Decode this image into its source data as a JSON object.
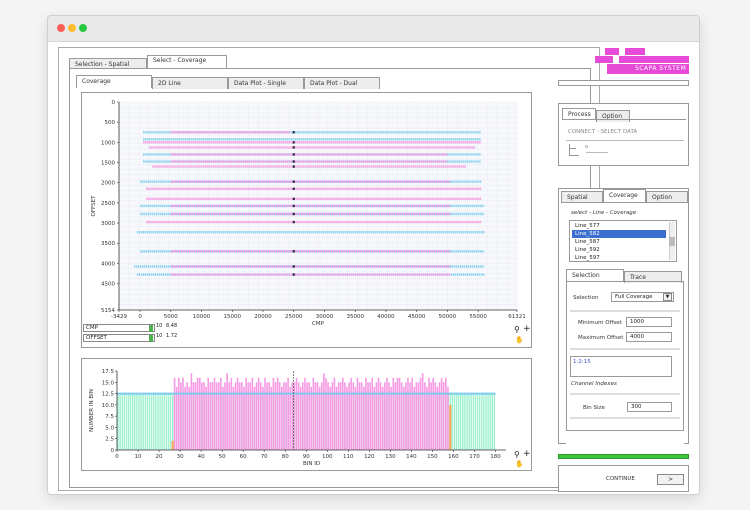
{
  "window": {
    "colors": {
      "close": "#ff5f57",
      "minimize": "#febc2e",
      "maximize": "#28c840"
    }
  },
  "left_tabs": {
    "spatial": "Selection - Spatial",
    "coverage": "Select - Coverage"
  },
  "inner_tabs": [
    "Coverage",
    "2D Line",
    "Data Plot - Single",
    "Data Plot - Dual"
  ],
  "coverage_plot": {
    "controls": {
      "cmp_label": "CMP",
      "offset_label": "OFFSET",
      "cmp_step_a": "10",
      "cmp_step_b": "8.48",
      "offset_step_a": "10",
      "offset_step_b": "1.72"
    }
  },
  "right": {
    "logo_text": "SCAPA SYSTEM",
    "process_tabs": [
      "Process",
      "Option"
    ],
    "connect_text": "CONNECT - SELECT DATA",
    "coverage_tabs": [
      "Spatial",
      "Coverage",
      "Option"
    ],
    "select_label": "select - Line - Coverage",
    "lines": [
      "Line_577",
      "Line_582",
      "Line_587",
      "Line_592",
      "Line_597"
    ],
    "selected_line": "Line_582",
    "sub_tabs": [
      "Selection",
      "Trace"
    ],
    "selection_label": "Selection",
    "selection_value": "Full Coverage",
    "min_offset_label": "Minimum Offset",
    "min_offset": "1000",
    "max_offset_label": "Maximum Offset",
    "max_offset": "4000",
    "channel_value": "1:2:15",
    "channel_label": "Channel Indexes",
    "bin_size_label": "Bin Size",
    "bin_size": "300",
    "continue_label": "CONTINUE",
    "continue_arrow": ">",
    "accent": "#e64bd8",
    "progress_color": "#3ec43e"
  },
  "chart_data": [
    {
      "type": "scatter",
      "title": "",
      "xlabel": "CMP",
      "ylabel": "OFFSET",
      "xlim": [
        -3429,
        61321
      ],
      "ylim": [
        5154,
        0
      ],
      "x_ticks": [
        "-3429",
        "0",
        "5000",
        "10000",
        "15000",
        "20000",
        "25000",
        "30000",
        "35000",
        "40000",
        "45000",
        "50000",
        "55000",
        "61321"
      ],
      "y_ticks": [
        "0",
        "500",
        "1000",
        "1500",
        "2000",
        "2500",
        "3000",
        "3500",
        "4000",
        "4500",
        "5154"
      ],
      "series": [
        {
          "color": "#88d0ee",
          "rows": [
            {
              "offset": 750,
              "x_from": 500,
              "x_to": 55500
            },
            {
              "offset": 925,
              "x_from": 500,
              "x_to": 55500
            },
            {
              "offset": 1300,
              "x_from": 500,
              "x_to": 55500
            },
            {
              "offset": 1475,
              "x_from": 500,
              "x_to": 55500
            },
            {
              "offset": 1975,
              "x_from": 0,
              "x_to": 55500
            },
            {
              "offset": 2575,
              "x_from": 0,
              "x_to": 56000
            },
            {
              "offset": 2775,
              "x_from": 0,
              "x_to": 56000
            },
            {
              "offset": 3225,
              "x_from": -500,
              "x_to": 56000
            },
            {
              "offset": 3700,
              "x_from": 0,
              "x_to": 56000
            },
            {
              "offset": 4075,
              "x_from": -1000,
              "x_to": 56000
            },
            {
              "offset": 4275,
              "x_from": -500,
              "x_to": 56000
            }
          ]
        },
        {
          "color": "#f59ae3",
          "rows": [
            {
              "offset": 750,
              "x_from": 5000,
              "x_to": 24500
            },
            {
              "offset": 1000,
              "x_from": 500,
              "x_to": 55500
            },
            {
              "offset": 1125,
              "x_from": 1500,
              "x_to": 54500
            },
            {
              "offset": 1300,
              "x_from": 5000,
              "x_to": 50000
            },
            {
              "offset": 1475,
              "x_from": 5000,
              "x_to": 50000
            },
            {
              "offset": 1600,
              "x_from": 2000,
              "x_to": 53000
            },
            {
              "offset": 1975,
              "x_from": 5000,
              "x_to": 50500
            },
            {
              "offset": 2150,
              "x_from": 1000,
              "x_to": 55500
            },
            {
              "offset": 2400,
              "x_from": 1000,
              "x_to": 55500
            },
            {
              "offset": 2575,
              "x_from": 5000,
              "x_to": 50500
            },
            {
              "offset": 2775,
              "x_from": 5000,
              "x_to": 50500
            },
            {
              "offset": 2975,
              "x_from": 1000,
              "x_to": 55500
            },
            {
              "offset": 3700,
              "x_from": 5000,
              "x_to": 50500
            },
            {
              "offset": 4075,
              "x_from": 5000,
              "x_to": 50500
            },
            {
              "offset": 4275,
              "x_from": 5000,
              "x_to": 50500
            }
          ]
        }
      ],
      "marker_x": 25000
    },
    {
      "type": "bar",
      "title": "",
      "xlabel": "BIN ID",
      "ylabel": "NUMBER IN BIN",
      "xlim": [
        0,
        185
      ],
      "ylim": [
        0,
        17.5
      ],
      "x_ticks": [
        "0",
        "10",
        "20",
        "30",
        "40",
        "50",
        "60",
        "70",
        "80",
        "90",
        "100",
        "110",
        "120",
        "130",
        "140",
        "150",
        "160",
        "170",
        "180"
      ],
      "y_ticks": [
        "0",
        "2.5",
        "5.0",
        "7.5",
        "10.0",
        "12.5",
        "15.0",
        "17.5"
      ],
      "bins_from": 27,
      "bins_to": 157,
      "bin_values": [
        16,
        14,
        16,
        15,
        16,
        14,
        15,
        14,
        17,
        15,
        15,
        16,
        16,
        15,
        15,
        14,
        16,
        15,
        15,
        16,
        15,
        15,
        16,
        14,
        15,
        17,
        15,
        16,
        14,
        15,
        16,
        15,
        15,
        14,
        16,
        15,
        15,
        16,
        14,
        15,
        16,
        15,
        14,
        16,
        15,
        15,
        14,
        16,
        15,
        16,
        15,
        14,
        15,
        15,
        16,
        14,
        15,
        15,
        16,
        15,
        14,
        15,
        16,
        15,
        15,
        14,
        16,
        15,
        15,
        14,
        15,
        17,
        16,
        15,
        14,
        15,
        16,
        14,
        15,
        15,
        16,
        15,
        14,
        15,
        16,
        15,
        14,
        16,
        15,
        15,
        14,
        16,
        15,
        15,
        16,
        14,
        15,
        16,
        15,
        14,
        15,
        16,
        15,
        14,
        16,
        15,
        16,
        16,
        15,
        14,
        15,
        16,
        15,
        16,
        14,
        15,
        15,
        16,
        17,
        15,
        14,
        16,
        15,
        16,
        15,
        14,
        15,
        16,
        15,
        16,
        14
      ],
      "baseline_value": 12.5,
      "marker_x": 84,
      "colors": {
        "bar": "#f59ae3",
        "line": "#7fc8ee",
        "cap": "#f7a55a",
        "back": "#9ff0cf"
      }
    }
  ]
}
